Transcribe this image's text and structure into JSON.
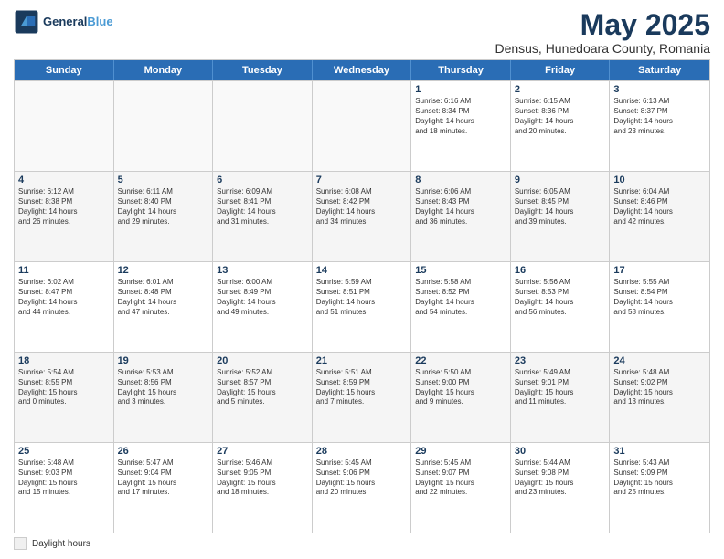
{
  "logo": {
    "line1": "General",
    "line2": "Blue"
  },
  "title": "May 2025",
  "subtitle": "Densus, Hunedoara County, Romania",
  "days": [
    "Sunday",
    "Monday",
    "Tuesday",
    "Wednesday",
    "Thursday",
    "Friday",
    "Saturday"
  ],
  "legend_label": "Daylight hours",
  "weeks": [
    [
      {
        "day": "",
        "info": ""
      },
      {
        "day": "",
        "info": ""
      },
      {
        "day": "",
        "info": ""
      },
      {
        "day": "",
        "info": ""
      },
      {
        "day": "1",
        "info": "Sunrise: 6:16 AM\nSunset: 8:34 PM\nDaylight: 14 hours\nand 18 minutes."
      },
      {
        "day": "2",
        "info": "Sunrise: 6:15 AM\nSunset: 8:36 PM\nDaylight: 14 hours\nand 20 minutes."
      },
      {
        "day": "3",
        "info": "Sunrise: 6:13 AM\nSunset: 8:37 PM\nDaylight: 14 hours\nand 23 minutes."
      }
    ],
    [
      {
        "day": "4",
        "info": "Sunrise: 6:12 AM\nSunset: 8:38 PM\nDaylight: 14 hours\nand 26 minutes."
      },
      {
        "day": "5",
        "info": "Sunrise: 6:11 AM\nSunset: 8:40 PM\nDaylight: 14 hours\nand 29 minutes."
      },
      {
        "day": "6",
        "info": "Sunrise: 6:09 AM\nSunset: 8:41 PM\nDaylight: 14 hours\nand 31 minutes."
      },
      {
        "day": "7",
        "info": "Sunrise: 6:08 AM\nSunset: 8:42 PM\nDaylight: 14 hours\nand 34 minutes."
      },
      {
        "day": "8",
        "info": "Sunrise: 6:06 AM\nSunset: 8:43 PM\nDaylight: 14 hours\nand 36 minutes."
      },
      {
        "day": "9",
        "info": "Sunrise: 6:05 AM\nSunset: 8:45 PM\nDaylight: 14 hours\nand 39 minutes."
      },
      {
        "day": "10",
        "info": "Sunrise: 6:04 AM\nSunset: 8:46 PM\nDaylight: 14 hours\nand 42 minutes."
      }
    ],
    [
      {
        "day": "11",
        "info": "Sunrise: 6:02 AM\nSunset: 8:47 PM\nDaylight: 14 hours\nand 44 minutes."
      },
      {
        "day": "12",
        "info": "Sunrise: 6:01 AM\nSunset: 8:48 PM\nDaylight: 14 hours\nand 47 minutes."
      },
      {
        "day": "13",
        "info": "Sunrise: 6:00 AM\nSunset: 8:49 PM\nDaylight: 14 hours\nand 49 minutes."
      },
      {
        "day": "14",
        "info": "Sunrise: 5:59 AM\nSunset: 8:51 PM\nDaylight: 14 hours\nand 51 minutes."
      },
      {
        "day": "15",
        "info": "Sunrise: 5:58 AM\nSunset: 8:52 PM\nDaylight: 14 hours\nand 54 minutes."
      },
      {
        "day": "16",
        "info": "Sunrise: 5:56 AM\nSunset: 8:53 PM\nDaylight: 14 hours\nand 56 minutes."
      },
      {
        "day": "17",
        "info": "Sunrise: 5:55 AM\nSunset: 8:54 PM\nDaylight: 14 hours\nand 58 minutes."
      }
    ],
    [
      {
        "day": "18",
        "info": "Sunrise: 5:54 AM\nSunset: 8:55 PM\nDaylight: 15 hours\nand 0 minutes."
      },
      {
        "day": "19",
        "info": "Sunrise: 5:53 AM\nSunset: 8:56 PM\nDaylight: 15 hours\nand 3 minutes."
      },
      {
        "day": "20",
        "info": "Sunrise: 5:52 AM\nSunset: 8:57 PM\nDaylight: 15 hours\nand 5 minutes."
      },
      {
        "day": "21",
        "info": "Sunrise: 5:51 AM\nSunset: 8:59 PM\nDaylight: 15 hours\nand 7 minutes."
      },
      {
        "day": "22",
        "info": "Sunrise: 5:50 AM\nSunset: 9:00 PM\nDaylight: 15 hours\nand 9 minutes."
      },
      {
        "day": "23",
        "info": "Sunrise: 5:49 AM\nSunset: 9:01 PM\nDaylight: 15 hours\nand 11 minutes."
      },
      {
        "day": "24",
        "info": "Sunrise: 5:48 AM\nSunset: 9:02 PM\nDaylight: 15 hours\nand 13 minutes."
      }
    ],
    [
      {
        "day": "25",
        "info": "Sunrise: 5:48 AM\nSunset: 9:03 PM\nDaylight: 15 hours\nand 15 minutes."
      },
      {
        "day": "26",
        "info": "Sunrise: 5:47 AM\nSunset: 9:04 PM\nDaylight: 15 hours\nand 17 minutes."
      },
      {
        "day": "27",
        "info": "Sunrise: 5:46 AM\nSunset: 9:05 PM\nDaylight: 15 hours\nand 18 minutes."
      },
      {
        "day": "28",
        "info": "Sunrise: 5:45 AM\nSunset: 9:06 PM\nDaylight: 15 hours\nand 20 minutes."
      },
      {
        "day": "29",
        "info": "Sunrise: 5:45 AM\nSunset: 9:07 PM\nDaylight: 15 hours\nand 22 minutes."
      },
      {
        "day": "30",
        "info": "Sunrise: 5:44 AM\nSunset: 9:08 PM\nDaylight: 15 hours\nand 23 minutes."
      },
      {
        "day": "31",
        "info": "Sunrise: 5:43 AM\nSunset: 9:09 PM\nDaylight: 15 hours\nand 25 minutes."
      }
    ]
  ]
}
